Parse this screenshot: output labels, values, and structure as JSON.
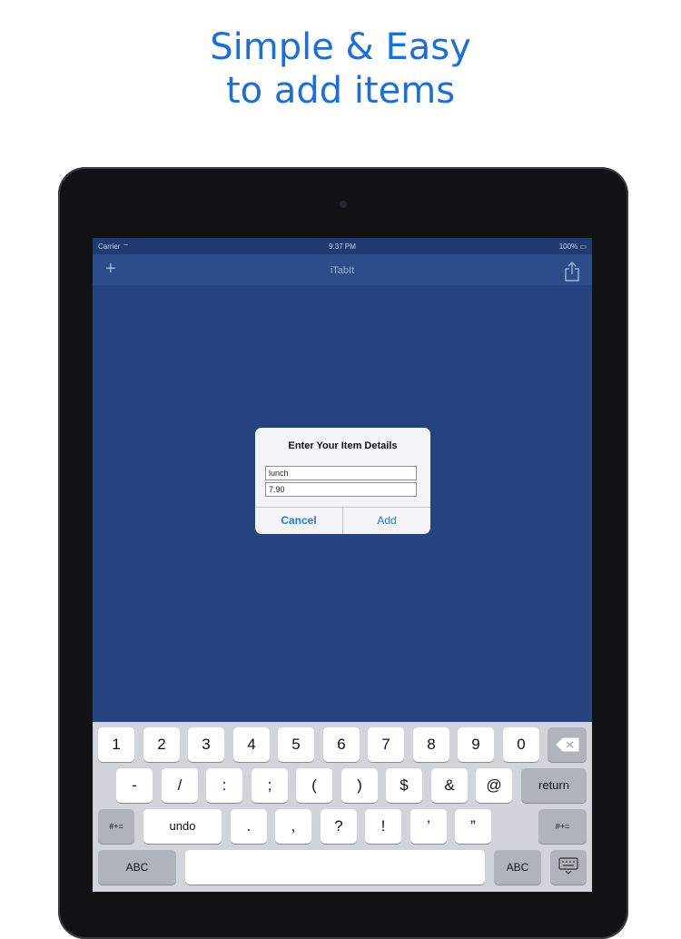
{
  "headline": {
    "line1": "Simple & Easy",
    "line2": "to add items"
  },
  "statusbar": {
    "carrier": "Carrier",
    "time": "9:37 PM",
    "battery": "100%"
  },
  "navbar": {
    "add_icon": "+",
    "title": "iTabIt",
    "share_icon": "share-icon"
  },
  "dialog": {
    "title": "Enter Your Item Details",
    "field1_value": "lunch",
    "field2_value": "7.90",
    "cancel_label": "Cancel",
    "add_label": "Add"
  },
  "keyboard": {
    "row1": [
      "1",
      "2",
      "3",
      "4",
      "5",
      "6",
      "7",
      "8",
      "9",
      "0"
    ],
    "row2": [
      "-",
      "/",
      ":",
      ";",
      "(",
      ")",
      "$",
      "&",
      "@"
    ],
    "return_label": "return",
    "row3_left": "#+=",
    "undo_label": "undo",
    "row3": [
      ".",
      ",",
      "?",
      "!",
      "’",
      "”"
    ],
    "row3_right": "#+=",
    "abc_left": "ABC",
    "abc_right": "ABC"
  },
  "colors": {
    "accent": "#1a6fd8",
    "screen_bg": "#24437f",
    "button_text": "#1a7cf5"
  }
}
